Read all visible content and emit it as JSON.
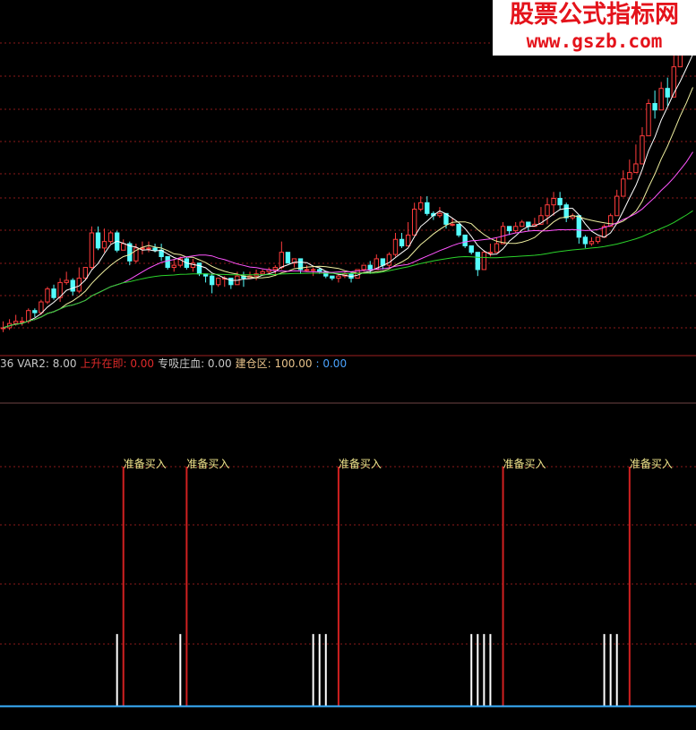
{
  "watermark": {
    "line1": "股票公式指标网",
    "line2": "www.gszb.com"
  },
  "legend": [
    {
      "label": "36",
      "value": "",
      "color": "#c8c8c8"
    },
    {
      "label": "VAR2:",
      "value": "8.00",
      "color": "#c8c8c8"
    },
    {
      "label": "上升在即:",
      "value": "0.00",
      "color": "#e02a2a"
    },
    {
      "label": "专吸庄血:",
      "value": "0.00",
      "color": "#c8c8c8"
    },
    {
      "label": "建仓区:",
      "value": "100.00",
      "color": "#e8c28a"
    },
    {
      "label": ":",
      "value": "0.00",
      "color": "#4aa3ff"
    }
  ],
  "colors": {
    "up": "#ff3c3c",
    "down": "#54fcfc",
    "ma_short": "#ffffff",
    "ma_mid": "#f0f0a0",
    "ma_long": "#ff55ff",
    "ma_base": "#2bd42b",
    "signal": "#d02020",
    "white_bar": "#ffffff",
    "baseline": "#3ab0ff",
    "signal_label": "#f0e68c",
    "grid": "#8b1a1a"
  },
  "chart_data": [
    {
      "type": "candlestick",
      "title": "",
      "count": 110,
      "ylim": [
        0,
        100
      ],
      "grid": "dashed-horizontal",
      "ohlc": [
        [
          5,
          5,
          8,
          3
        ],
        [
          5,
          7,
          9,
          4
        ],
        [
          7,
          8,
          11,
          6
        ],
        [
          8,
          8,
          10,
          6
        ],
        [
          8,
          13,
          14,
          7
        ],
        [
          13,
          12,
          14,
          10
        ],
        [
          12,
          17,
          18,
          11
        ],
        [
          17,
          23,
          24,
          16
        ],
        [
          23,
          19,
          25,
          18
        ],
        [
          19,
          26,
          28,
          17
        ],
        [
          26,
          27,
          31,
          25
        ],
        [
          27,
          22,
          28,
          20
        ],
        [
          22,
          28,
          33,
          21
        ],
        [
          28,
          33,
          33,
          27
        ],
        [
          33,
          49,
          52,
          32
        ],
        [
          49,
          42,
          52,
          41
        ],
        [
          42,
          45,
          51,
          40
        ],
        [
          45,
          49,
          50,
          44
        ],
        [
          49,
          41,
          50,
          40
        ],
        [
          41,
          44,
          46,
          42
        ],
        [
          44,
          36,
          45,
          34
        ],
        [
          36,
          42,
          44,
          35
        ],
        [
          42,
          42,
          45,
          39
        ],
        [
          42,
          42,
          45,
          40
        ],
        [
          42,
          41,
          44,
          40
        ],
        [
          41,
          38,
          44,
          36
        ],
        [
          38,
          33,
          38,
          32
        ],
        [
          33,
          34,
          37,
          31
        ],
        [
          34,
          37,
          38,
          33
        ],
        [
          37,
          33,
          38,
          32
        ],
        [
          33,
          35,
          37,
          31
        ],
        [
          35,
          30,
          35,
          29
        ],
        [
          30,
          29,
          30,
          26
        ],
        [
          29,
          25,
          30,
          21
        ],
        [
          25,
          28,
          28,
          24
        ],
        [
          28,
          28,
          29,
          24
        ],
        [
          28,
          25,
          27,
          23
        ],
        [
          25,
          29,
          31,
          25
        ],
        [
          29,
          28,
          31,
          24
        ],
        [
          28,
          29,
          31,
          28
        ],
        [
          29,
          30,
          32,
          27
        ],
        [
          30,
          31,
          32,
          30
        ],
        [
          31,
          32,
          33,
          30
        ],
        [
          32,
          33,
          34,
          29
        ],
        [
          33,
          40,
          45,
          32
        ],
        [
          40,
          35,
          37,
          36
        ],
        [
          35,
          37,
          37,
          33
        ],
        [
          37,
          32,
          34,
          30
        ],
        [
          32,
          32,
          34,
          31
        ],
        [
          32,
          32,
          33,
          29
        ],
        [
          32,
          31,
          33,
          30
        ],
        [
          31,
          29,
          29,
          28
        ],
        [
          29,
          28,
          29,
          27
        ],
        [
          28,
          29,
          30,
          26
        ],
        [
          29,
          30,
          31,
          28
        ],
        [
          30,
          28,
          31,
          26
        ],
        [
          28,
          32,
          32,
          28
        ],
        [
          32,
          34,
          34,
          31
        ],
        [
          34,
          32,
          36,
          30
        ],
        [
          32,
          37,
          39,
          33
        ],
        [
          37,
          34,
          34,
          32
        ],
        [
          34,
          39,
          40,
          33
        ],
        [
          39,
          46,
          49,
          38
        ],
        [
          46,
          43,
          49,
          42
        ],
        [
          43,
          48,
          54,
          45
        ],
        [
          48,
          60,
          63,
          52
        ],
        [
          60,
          63,
          66,
          59
        ],
        [
          63,
          58,
          66,
          57
        ],
        [
          58,
          57,
          59,
          55
        ],
        [
          57,
          58,
          61,
          56
        ],
        [
          58,
          53,
          56,
          51
        ],
        [
          53,
          53,
          56,
          52
        ],
        [
          53,
          48,
          53,
          47
        ],
        [
          48,
          43,
          46,
          42
        ],
        [
          43,
          40,
          43,
          39
        ],
        [
          40,
          32,
          38,
          29
        ],
        [
          32,
          40,
          41,
          34
        ],
        [
          40,
          40,
          44,
          38
        ],
        [
          40,
          44,
          47,
          42
        ],
        [
          44,
          52,
          54,
          44
        ],
        [
          52,
          50,
          51,
          48
        ],
        [
          50,
          52,
          54,
          49
        ],
        [
          52,
          54,
          55,
          53
        ],
        [
          54,
          52,
          54,
          50
        ],
        [
          52,
          53,
          56,
          52
        ],
        [
          53,
          57,
          61,
          55
        ],
        [
          57,
          62,
          65,
          53
        ],
        [
          62,
          65,
          68,
          57
        ],
        [
          65,
          62,
          68,
          60
        ],
        [
          62,
          56,
          63,
          54
        ],
        [
          56,
          57,
          58,
          55
        ],
        [
          57,
          47,
          51,
          44
        ],
        [
          47,
          44,
          48,
          42
        ],
        [
          44,
          45,
          47,
          43
        ],
        [
          45,
          47,
          47,
          44
        ],
        [
          47,
          52,
          53,
          47
        ],
        [
          52,
          57,
          58,
          52
        ],
        [
          57,
          66,
          69,
          64
        ],
        [
          66,
          74,
          78,
          68
        ],
        [
          74,
          77,
          83,
          76
        ],
        [
          77,
          81,
          90,
          77
        ],
        [
          81,
          94,
          98,
          87
        ],
        [
          94,
          109,
          111,
          94
        ],
        [
          109,
          106,
          115,
          102
        ],
        [
          106,
          116,
          119,
          108
        ],
        [
          116,
          112,
          121,
          108
        ],
        [
          112,
          126,
          138,
          123
        ],
        [
          126,
          136,
          142,
          131
        ],
        [
          136,
          137,
          143,
          133
        ],
        [
          137,
          148,
          149,
          137
        ]
      ],
      "moving_averages": [
        {
          "name": "MA5",
          "period": 5,
          "color": "#ffffff"
        },
        {
          "name": "MA10",
          "period": 10,
          "color": "#f0f0a0"
        },
        {
          "name": "MA20",
          "period": 20,
          "color": "#ff55ff"
        },
        {
          "name": "MA60",
          "period": 60,
          "color": "#2bd42b"
        }
      ]
    },
    {
      "type": "bar",
      "title": "",
      "ylim": [
        0,
        100
      ],
      "signal_label": "准备买入",
      "signals": [
        {
          "x": 19,
          "value": 100,
          "label": "准备买入"
        },
        {
          "x": 29,
          "value": 100,
          "label": "准备买入"
        },
        {
          "x": 53,
          "value": 100,
          "label": "准备买入"
        },
        {
          "x": 79,
          "value": 100,
          "label": "准备买入"
        },
        {
          "x": 99,
          "value": 100,
          "label": "准备买入"
        }
      ],
      "white_bars": [
        {
          "x": 18,
          "value": 30
        },
        {
          "x": 28,
          "value": 30
        },
        {
          "x": 49,
          "value": 30
        },
        {
          "x": 50,
          "value": 30
        },
        {
          "x": 51,
          "value": 30
        },
        {
          "x": 74,
          "value": 30
        },
        {
          "x": 75,
          "value": 30
        },
        {
          "x": 76,
          "value": 30
        },
        {
          "x": 77,
          "value": 30
        },
        {
          "x": 95,
          "value": 30
        },
        {
          "x": 96,
          "value": 30
        },
        {
          "x": 97,
          "value": 30
        }
      ]
    }
  ]
}
